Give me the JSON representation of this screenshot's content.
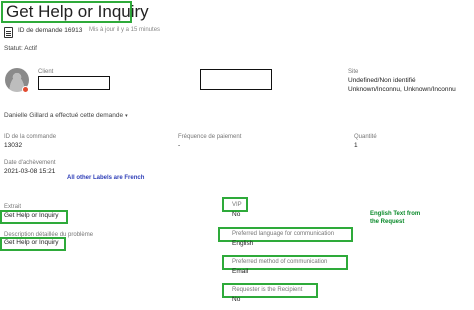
{
  "header": {
    "title": "Get Help or Inquiry",
    "request_id": "ID de demande 16913",
    "updated": "Mis à jour il y a 15 minutes",
    "status": "Statut: Actif"
  },
  "client": {
    "label": "Client",
    "actor": "Danielle Gillard a effectué cette demande",
    "caret": "▾"
  },
  "site": {
    "label": "Site",
    "line1": "Undefined/Non identifié",
    "line2": "Unknown/Inconnu, Unknown/Inconnu"
  },
  "order": {
    "label": "ID de la commande",
    "value": "13032"
  },
  "payment": {
    "label": "Fréquence de paiement",
    "value": "-"
  },
  "quantity": {
    "label": "Quantité",
    "value": "1"
  },
  "completion": {
    "label": "Date d'achèvement",
    "value": "2021-03-08 15:21"
  },
  "notes": {
    "french": "All other Labels are French",
    "english_1": "English Text from",
    "english_2": "the Request"
  },
  "summary": {
    "label": "Extrait",
    "value": "Get Help or Inquiry"
  },
  "description": {
    "label": "Description détaillée du problème",
    "value": "Get Help or Inquiry"
  },
  "vip": {
    "label": "VIP",
    "value": "No"
  },
  "pref_language": {
    "label": "Preferred language for communication",
    "value": "English"
  },
  "pref_method": {
    "label": "Preferred method of communication",
    "value": "Email"
  },
  "recipient": {
    "label": "Requester is the Recipient",
    "value": "No"
  },
  "colors": {
    "highlight": "#2eaa3a",
    "status_dot": "#e24a2f"
  }
}
